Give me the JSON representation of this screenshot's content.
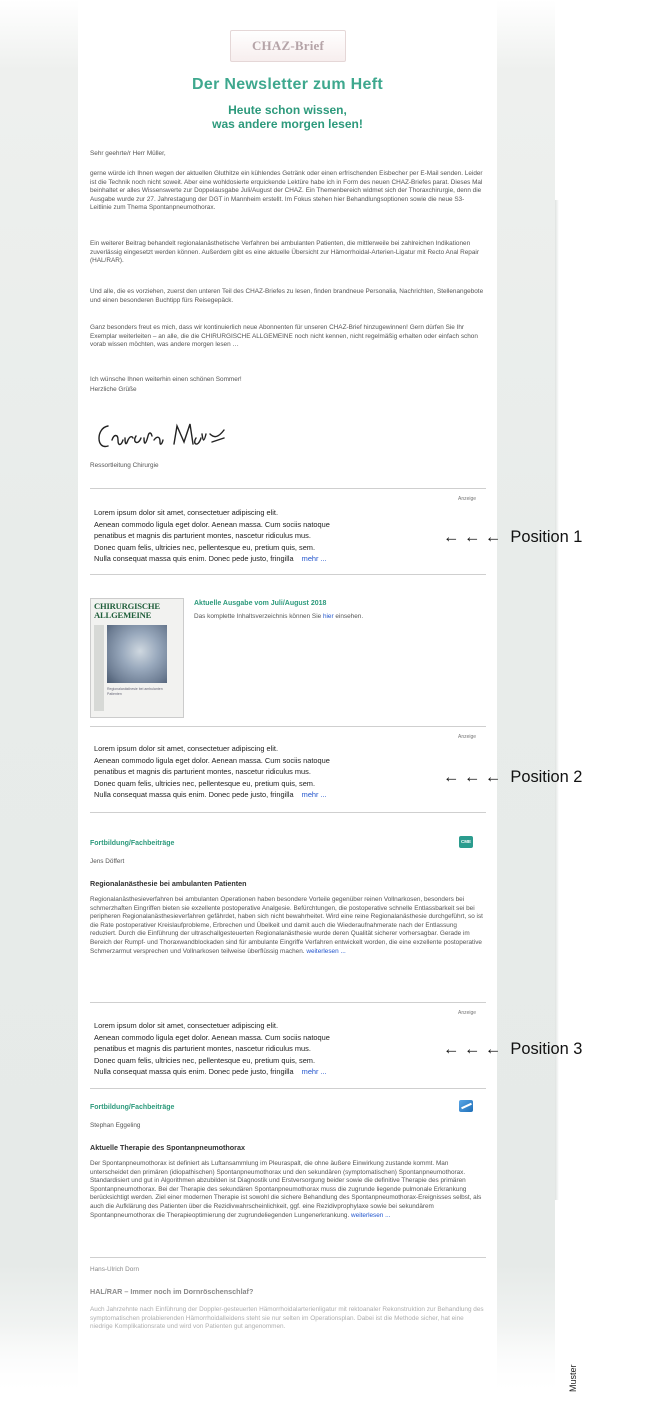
{
  "email": {
    "logo": "CHAZ-Brief",
    "title": "Der Newsletter zum Heft",
    "subtitle_line1": "Heute schon wissen,",
    "subtitle_line2": "was andere morgen lesen!",
    "greeting": "Sehr geehrte/r Herr Müller,",
    "p1": "gerne würde ich Ihnen wegen der aktuellen Gluthitze ein kühlendes Getränk oder einen erfrischenden Eisbecher per E-Mail senden. Leider ist die Technik noch nicht soweit. Aber eine wohldosierte erquickende Lektüre habe ich in Form des neuen CHAZ-Briefes parat. Dieses Mal beinhaltet er alles Wissenswerte zur Doppelausgabe Juli/August der CHAZ. Ein Themenbereich widmet sich der Thoraxchirurgie, denn die Ausgabe wurde zur 27. Jahrestagung der DGT in Mannheim erstellt. Im Fokus stehen hier Behandlungsoptionen sowie die neue S3-Leitlinie zum Thema Spontanpneumothorax.",
    "p2": "Ein weiterer Beitrag behandelt regionalanästhetische Verfahren bei ambulanten Patienten, die mittlerweile bei zahlreichen Indikationen zuverlässig eingesetzt werden können. Außerdem gibt es eine aktuelle Übersicht zur Hämorrhoidal-Arterien-Ligatur mit Recto Anal Repair (HAL/RAR).",
    "p3": "Und alle, die es vorziehen, zuerst den unteren Teil des CHAZ-Briefes zu lesen, finden brandneue Personalia, Nachrichten, Stellenangebote und einen besonderen Buchtipp fürs Reisegepäck.",
    "p4": "Ganz besonders freut es mich, dass wir kontinuierlich neue Abonnenten für unseren CHAZ-Brief hinzugewinnen! Gern dürfen Sie Ihr Exemplar weiterleiten – an alle, die die CHIRURGISCHE ALLGEMEINE noch nicht kennen, nicht regelmäßig erhalten oder einfach schon vorab wissen möchten, was andere morgen lesen …",
    "closing1": "Ich wünsche Ihnen weiterhin einen schönen Sommer!",
    "closing2": "Herzliche Grüße",
    "signature": "Carona Mac",
    "signature_role": "Ressortleitung Chirurgie"
  },
  "ads": {
    "label": "Anzeige",
    "line1": "Lorem ipsum dolor sit amet, consectetuer adipiscing elit.",
    "line2": "Aenean commodo ligula eget dolor. Aenean massa. Cum sociis natoque",
    "line3": "penatibus et magnis dis parturient montes, nascetur ridiculus mus.",
    "line4": "Donec quam felis, ultricies nec, pellentesque eu, pretium quis, sem.",
    "line5": "Nulla consequat massa quis enim. Donec pede justo, fringilla",
    "more": "mehr ..."
  },
  "issue": {
    "cover_title_1": "CHIRURGISCHE",
    "cover_title_2": "ALLGEMEINE",
    "cover_sub": "Regionalanästhesie bei ambulanten Patienten",
    "heading": "Aktuelle Ausgabe vom Juli/August 2018",
    "text_before": "Das komplette Inhaltsverzeichnis können Sie ",
    "link": "hier",
    "text_after": " einsehen."
  },
  "article1": {
    "category": "Fortbildung/Fachbeiträge",
    "author": "Jens Döffert",
    "title": "Regionalanästhesie bei ambulanten Patienten",
    "body": "Regionalanästhesieverfahren bei ambulanten Operationen haben besondere Vorteile gegenüber reinen Vollnarkosen, besonders bei schmerzhaften Eingriffen bieten sie exzellente postoperative Analgesie. Befürchtungen, die postoperative schnelle Entlassbarkeit sei bei peripheren Regionalanästhesieverfahren gefährdet, haben sich nicht bewahrheitet. Wird eine reine Regionalanästhesie durchgeführt, so ist die Rate postoperativer Kreislaufprobleme, Erbrechen und Übelkeit und damit auch die Wiederaufnahmerate nach der Entlassung reduziert. Durch die Einführung der ultraschallgesteuerten Regionalanästhesie wurde deren Qualität sicherer vorhersagbar. Gerade im Bereich der Rumpf- und Thoraxwandblockaden sind für ambulante Eingriffe Verfahren entwickelt worden, die eine exzellente postoperative Schmerzarmut versprechen und Vollnarkosen teilweise überflüssig machen.",
    "more": "weiterlesen ...",
    "badge": "CME"
  },
  "article2": {
    "category": "Fortbildung/Fachbeiträge",
    "author": "Stephan Eggeling",
    "title": "Aktuelle Therapie des Spontanpneumothorax",
    "body": "Der Spontanpneumothorax ist definiert als Luftansammlung im Pleuraspalt, die ohne äußere Einwirkung zustande kommt. Man unterscheidet den primären (idiopathischen) Spontanpneumothorax und den sekundären (symptomatischen) Spontanpneumothorax. Standardisiert und gut in Algorithmen abzubilden ist Diagnostik und Erstversorgung beider sowie die definitive Therapie des primären Spontanpneumothorax. Bei der Therapie des sekundären Spontanpneumothorax muss die zugrunde liegende pulmonale Erkrankung berücksichtigt werden. Ziel einer modernen Therapie ist sowohl die sichere Behandlung des Spontanpneumothorax-Ereignisses selbst, als auch die Aufklärung des Patienten über die Rezidivwahrscheinlichkeit, ggf. eine Rezidivprophylaxe sowie bei sekundärem Spontanpneumothorax die Therapieoptimierung der zugrundeliegenden Lungenerkrankung.",
    "more": "weiterlesen ..."
  },
  "article3": {
    "author": "Hans-Ulrich Dorn",
    "title": "HAL/RAR – Immer noch im Dornröschenschlaf?",
    "body": "Auch Jahrzehnte nach Einführung der Doppler-gesteuerten Hämorrhoidalarterienligatur mit rektoanaler Rekonstruktion zur Behandlung des symptomatischen prolabierenden Hämorrhoidalleidens steht sie nur selten im Operationsplan. Dabei ist die Methode sicher, hat eine niedrige Komplikationsrate und wird von Patienten gut angenommen."
  },
  "positions": {
    "arrows": "← ← ←",
    "p1": "Position 1",
    "p2": "Position 2",
    "p3": "Position 3"
  },
  "watermark": "Muster"
}
